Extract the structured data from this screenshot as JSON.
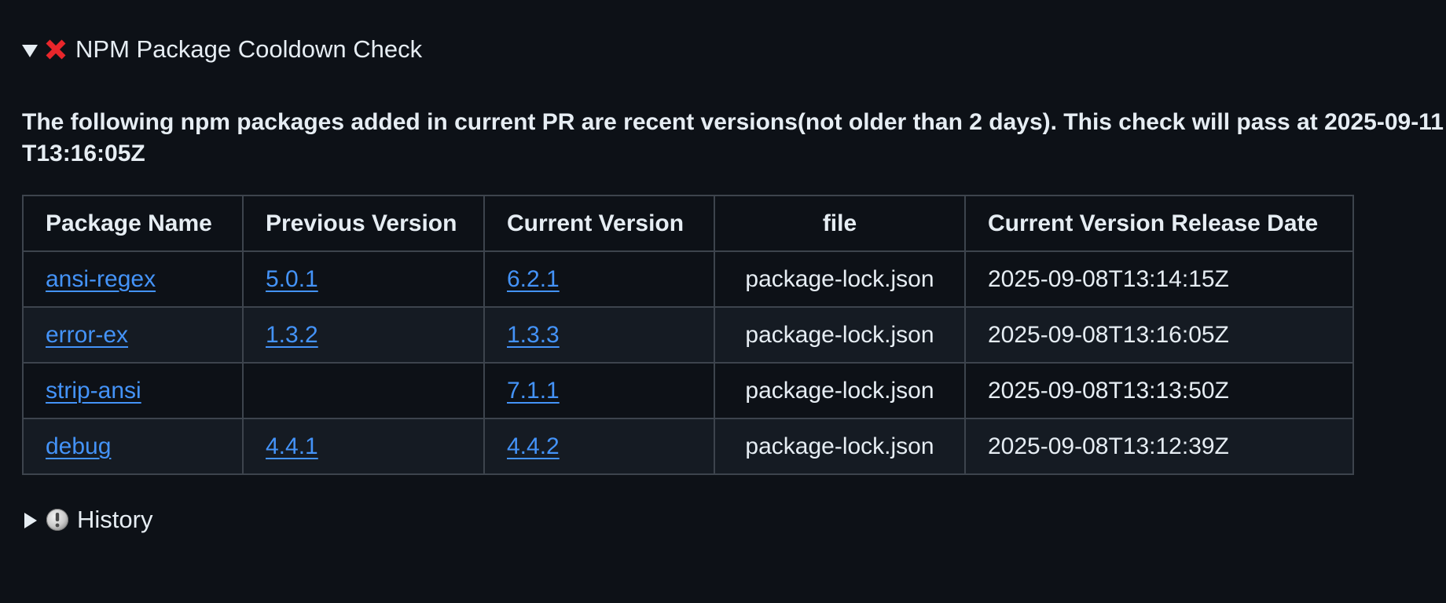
{
  "cooldown_check": {
    "expanded": true,
    "status_icon": "red-x-icon",
    "title": "NPM Package Cooldown Check",
    "message": "The following npm packages added in current PR are recent versions(not older than 2 days). This check will pass at 2025-09-11T13:16:05Z"
  },
  "table": {
    "headers": [
      "Package Name",
      "Previous Version",
      "Current Version",
      "file",
      "Current Version Release Date"
    ],
    "rows": [
      {
        "package": "ansi-regex",
        "previous": "5.0.1",
        "current": "6.2.1",
        "file": "package-lock.json",
        "release_date": "2025-09-08T13:14:15Z"
      },
      {
        "package": "error-ex",
        "previous": "1.3.2",
        "current": "1.3.3",
        "file": "package-lock.json",
        "release_date": "2025-09-08T13:16:05Z"
      },
      {
        "package": "strip-ansi",
        "previous": "",
        "current": "7.1.1",
        "file": "package-lock.json",
        "release_date": "2025-09-08T13:13:50Z"
      },
      {
        "package": "debug",
        "previous": "4.4.1",
        "current": "4.4.2",
        "file": "package-lock.json",
        "release_date": "2025-09-08T13:12:39Z"
      }
    ]
  },
  "history": {
    "expanded": false,
    "icon": "info-circle-icon",
    "title": "History"
  },
  "colors": {
    "background": "#0d1117",
    "text": "#e6edf3",
    "link": "#4493f8",
    "border": "#3d444d",
    "row_alt": "#151b23",
    "error_red": "#e8262b"
  }
}
